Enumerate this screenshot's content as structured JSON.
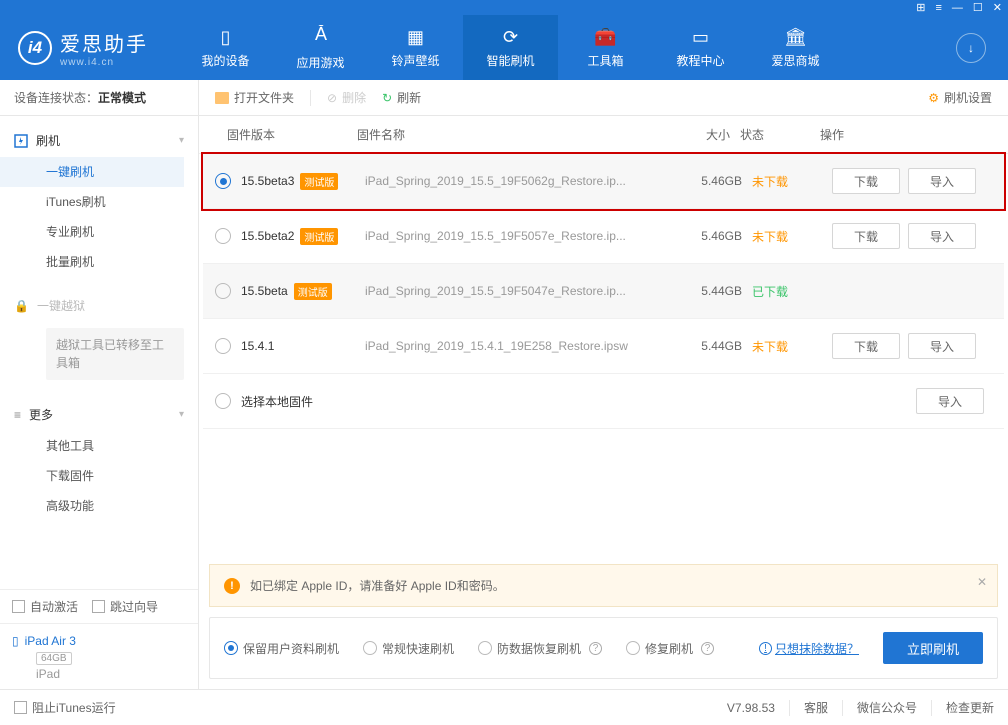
{
  "titlebar": {},
  "header": {
    "app_name": "爱思助手",
    "app_domain": "www.i4.cn",
    "nav": [
      {
        "label": "我的设备"
      },
      {
        "label": "应用游戏"
      },
      {
        "label": "铃声壁纸"
      },
      {
        "label": "智能刷机"
      },
      {
        "label": "工具箱"
      },
      {
        "label": "教程中心"
      },
      {
        "label": "爱思商城"
      }
    ]
  },
  "sidebar": {
    "conn_label": "设备连接状态：",
    "conn_value": "正常模式",
    "flash_head": "刷机",
    "flash_items": [
      "一键刷机",
      "iTunes刷机",
      "专业刷机",
      "批量刷机"
    ],
    "jailbreak_head": "一键越狱",
    "jailbreak_note": "越狱工具已转移至工具箱",
    "more_head": "更多",
    "more_items": [
      "其他工具",
      "下载固件",
      "高级功能"
    ],
    "auto_activate": "自动激活",
    "skip_guide": "跳过向导",
    "device_name": "iPad Air 3",
    "device_cap": "64GB",
    "device_type": "iPad"
  },
  "toolbar": {
    "open_folder": "打开文件夹",
    "delete": "删除",
    "refresh": "刷新",
    "settings": "刷机设置"
  },
  "table": {
    "head": [
      "固件版本",
      "固件名称",
      "大小",
      "状态",
      "操作"
    ],
    "beta_badge": "测试版",
    "rows": [
      {
        "version": "15.5beta3",
        "beta": true,
        "name": "iPad_Spring_2019_15.5_19F5062g_Restore.ip...",
        "size": "5.46GB",
        "status": "未下载",
        "status_color": "orange",
        "buttons": [
          "下载",
          "导入"
        ],
        "selected": true
      },
      {
        "version": "15.5beta2",
        "beta": true,
        "name": "iPad_Spring_2019_15.5_19F5057e_Restore.ip...",
        "size": "5.46GB",
        "status": "未下载",
        "status_color": "orange",
        "buttons": [
          "下载",
          "导入"
        ]
      },
      {
        "version": "15.5beta",
        "beta": true,
        "name": "iPad_Spring_2019_15.5_19F5047e_Restore.ip...",
        "size": "5.44GB",
        "status": "已下载",
        "status_color": "green",
        "buttons": []
      },
      {
        "version": "15.4.1",
        "beta": false,
        "name": "iPad_Spring_2019_15.4.1_19E258_Restore.ipsw",
        "size": "5.44GB",
        "status": "未下载",
        "status_color": "orange",
        "buttons": [
          "下载",
          "导入"
        ]
      },
      {
        "version": "选择本地固件",
        "beta": false,
        "name": "",
        "size": "",
        "status": "",
        "status_color": "",
        "buttons": [
          "导入"
        ]
      }
    ]
  },
  "notice": "如已绑定 Apple ID，请准备好 Apple ID和密码。",
  "action": {
    "options": [
      "保留用户资料刷机",
      "常规快速刷机",
      "防数据恢复刷机",
      "修复刷机"
    ],
    "only_erase": "只想抹除数据？",
    "flash_now": "立即刷机"
  },
  "statusbar": {
    "block_itunes": "阻止iTunes运行",
    "version": "V7.98.53",
    "support": "客服",
    "wechat": "微信公众号",
    "check_update": "检查更新"
  }
}
